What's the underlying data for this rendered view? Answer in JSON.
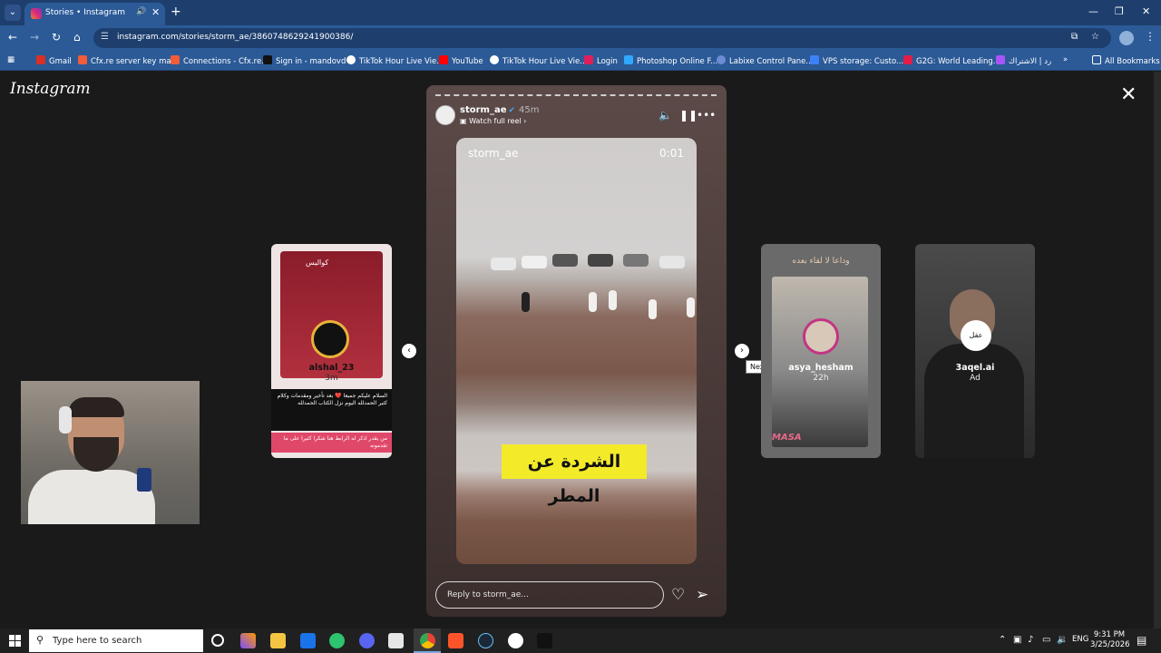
{
  "browser": {
    "tab_title": "Stories • Instagram",
    "url": "instagram.com/stories/storm_ae/3860748629241900386/",
    "bookmarks": [
      {
        "label": "Gmail",
        "color": "#d93025"
      },
      {
        "label": "Cfx.re server key ma...",
        "color": "#f25c3a"
      },
      {
        "label": "Connections - Cfx.re...",
        "color": "#f25c3a"
      },
      {
        "label": "Sign in - mandovd",
        "color": "#111111"
      },
      {
        "label": "TikTok Hour Live Vie...",
        "color": "#ffffff"
      },
      {
        "label": "YouTube",
        "color": "#ff0000"
      },
      {
        "label": "TikTok Hour Live Vie...",
        "color": "#ffffff"
      },
      {
        "label": "Login",
        "color": "#e01e5a"
      },
      {
        "label": "Photoshop Online F...",
        "color": "#31a8ff"
      },
      {
        "label": "Labixe Control Pane...",
        "color": "#6c8cd5"
      },
      {
        "label": "VPS storage: Custo...",
        "color": "#3b82f6"
      },
      {
        "label": "G2G: World Leading...",
        "color": "#e11d48"
      },
      {
        "label": "رد | الاشتراك",
        "color": "#a855f7"
      }
    ],
    "all_bookmarks": "All Bookmarks"
  },
  "instagram": {
    "logo": "Instagram",
    "story": {
      "username": "storm_ae",
      "time_ago": "45m",
      "watch_full_reel": "Watch full reel",
      "video_username": "storm_ae",
      "video_timer": "0:01",
      "caption": "الشردة عن المطر",
      "reply_placeholder": "Reply to storm_ae..."
    },
    "left_story": {
      "username": "alshal_23",
      "time_ago": "3m",
      "banner_text": "كواليس",
      "post_text": "السلام عليكم جميعا ❤️ بعد تأخير ومقدمات وكلام كثير الحمدلله اليوم نزل الكتاب الحمدلله",
      "footer_text": "من يقدر اذكر له الرابط هنا شكرا كثيرا على ما تقدمونه"
    },
    "next_story": {
      "username": "asya_hesham",
      "time_ago": "22h",
      "header_text": "وداعا لا لقاء بعده",
      "brand": "MASA"
    },
    "ad_story": {
      "badge_text": "عقل",
      "username": "3aqel.ai",
      "label": "Ad"
    },
    "tooltip": "Next"
  },
  "taskbar": {
    "search_placeholder": "Type here to search",
    "language": "ENG",
    "time": "9:31 PM",
    "date": "3/25/2026"
  }
}
